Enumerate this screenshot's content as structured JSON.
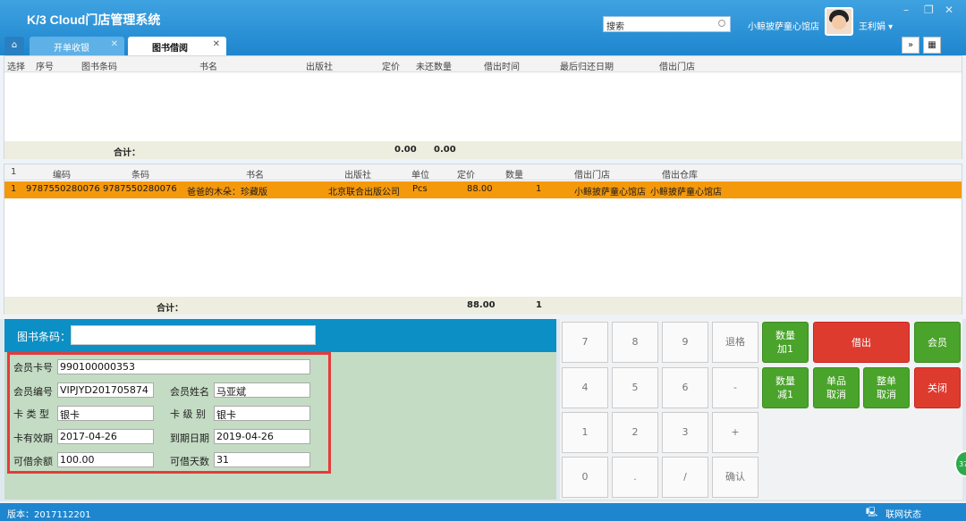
{
  "app": {
    "title": "K/3 Cloud门店管理系统",
    "search_placeholder": "搜索",
    "store": "小鲸披萨童心馆店",
    "user": "王利娟 ▾"
  },
  "tabs": [
    {
      "label": "开单收银"
    },
    {
      "label": "图书借阅"
    }
  ],
  "top_grid": {
    "headers": [
      "选择",
      "序号",
      "图书条码",
      "书名",
      "出版社",
      "定价",
      "未还数量",
      "借出时间",
      "最后归还日期",
      "借出门店"
    ],
    "footer_label": "合计：",
    "footer_price": "0.00",
    "footer_qty": "0.00"
  },
  "main_grid": {
    "headers": [
      "1",
      "编码",
      "条码",
      "书名",
      "出版社",
      "单位",
      "定价",
      "数量",
      "借出门店",
      "借出仓库"
    ],
    "rows": [
      {
        "idx": "1",
        "code": "9787550280076",
        "barcode": "9787550280076",
        "name": "爸爸的木朵：珍藏版",
        "publisher": "北京联合出版公司",
        "unit": "Pcs",
        "price": "88.00",
        "qty": "1",
        "store": "小鲸披萨童心馆店",
        "warehouse": "小鲸披萨童心馆店"
      }
    ],
    "footer_label": "合计：",
    "footer_price": "88.00",
    "footer_qty": "1"
  },
  "barcode": {
    "label": "图书条码：",
    "value": ""
  },
  "member": {
    "card_no_label": "会员卡号",
    "card_no": "990100000353",
    "member_no_label": "会员编号",
    "member_no": "VIPJYD201705874",
    "name_label": "会员姓名",
    "name": "马亚斌",
    "card_type_label": "卡 类 型",
    "card_type": "银卡",
    "card_level_label": "卡 级 别",
    "card_level": "银卡",
    "valid_from_label": "卡有效期",
    "valid_from": "2017-04-26",
    "expire_label": "到期日期",
    "expire": "2019-04-26",
    "balance_label": "可借余额",
    "balance": "100.00",
    "days_label": "可借天数",
    "days": "31"
  },
  "keypad": {
    "k7": "7",
    "k8": "8",
    "k9": "9",
    "back": "退格",
    "k4": "4",
    "k5": "5",
    "k6": "6",
    "minus": "-",
    "k1": "1",
    "k2": "2",
    "k3": "3",
    "plus": "+",
    "k0": "0",
    "dot": ".",
    "slash": "/",
    "confirm": "确认"
  },
  "actions": {
    "qty_add": "数量加1",
    "borrow": "借出",
    "member": "会员",
    "qty_sub": "数量减1",
    "cancel_item": "单品取消",
    "cancel_all": "整单取消",
    "close": "关闭"
  },
  "status": {
    "version": "版本：2017112201",
    "network": "联网状态",
    "badge": "37"
  }
}
